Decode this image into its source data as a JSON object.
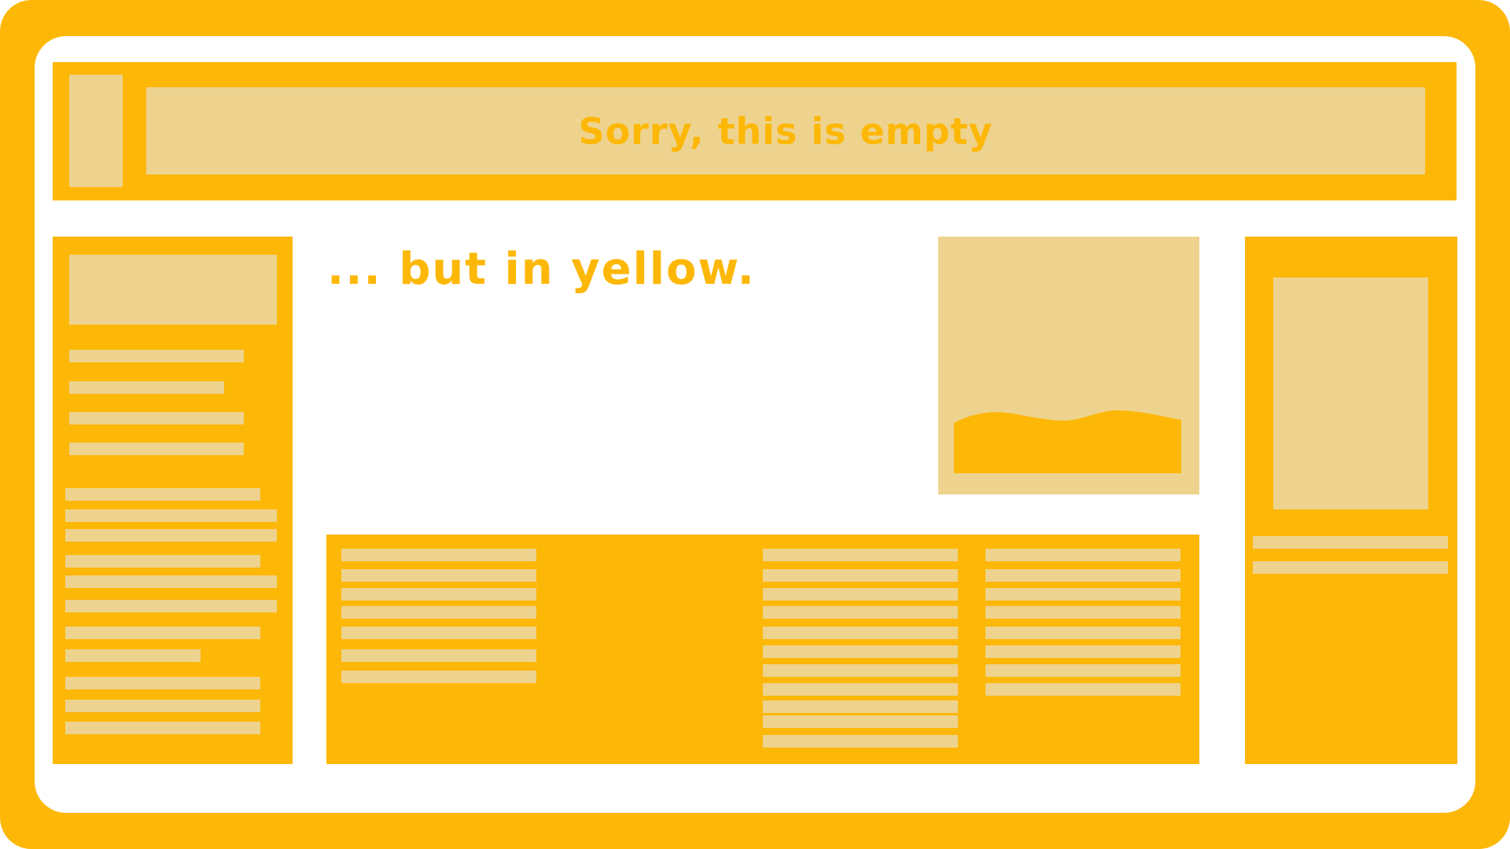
{
  "header": {
    "title": "Sorry, this is empty"
  },
  "main": {
    "heading": "... but in yellow."
  },
  "colors": {
    "accent": "#FDB706",
    "placeholder": "#EED38E",
    "background": "#FFFFFF"
  },
  "icons": {
    "image_placeholder": "landscape-image-icon"
  }
}
